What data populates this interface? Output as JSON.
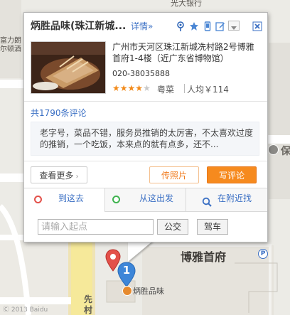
{
  "map": {
    "labels": {
      "top_bank": "光大银行",
      "left_hotel_line1": "富力朗",
      "left_hotel_line2": "尔顿酒",
      "right_edge": "保",
      "landmark": "博雅首府",
      "road_vertical": "先",
      "road_vertical2": "村",
      "marker_label": "炳胜品味",
      "footer": "Ⓒ 2013 Baidu"
    },
    "marker_number": "1",
    "colors": {
      "marker_blue": "#3d86d8",
      "marker_red": "#e3514a",
      "road_yellow": "#f6e99a",
      "map_bg": "#ecebe6"
    }
  },
  "popup": {
    "title": "炳胜品味(珠江新城...",
    "details_link": "详情»",
    "toolbar_icons": [
      "location-pin-icon",
      "star-icon",
      "phone-icon",
      "edit-icon",
      "dropdown-icon",
      "close-icon"
    ],
    "address": "广州市天河区珠江新城冼村路2号博雅首府1-4楼（近广东省博物馆）",
    "phone": "020-38035888",
    "rating": {
      "stars_filled": 4,
      "stars_total": 5
    },
    "cuisine": "粤菜",
    "per_capita": "人均￥114",
    "review_count": "共1790条评论",
    "review_text": "老字号，菜品不错，服务员推销的太厉害，不太喜欢过度的推销，一个吃饭，本来点的就有点多，还不...",
    "buttons": {
      "more": "查看更多",
      "upload_photo": "传照片",
      "write_review": "写评论"
    },
    "tabs": {
      "go_here": "到这去",
      "from_here": "从这出发",
      "nearby": "在附近找"
    },
    "route": {
      "start_placeholder": "请输入起点",
      "bus": "公交",
      "drive": "驾车"
    }
  }
}
